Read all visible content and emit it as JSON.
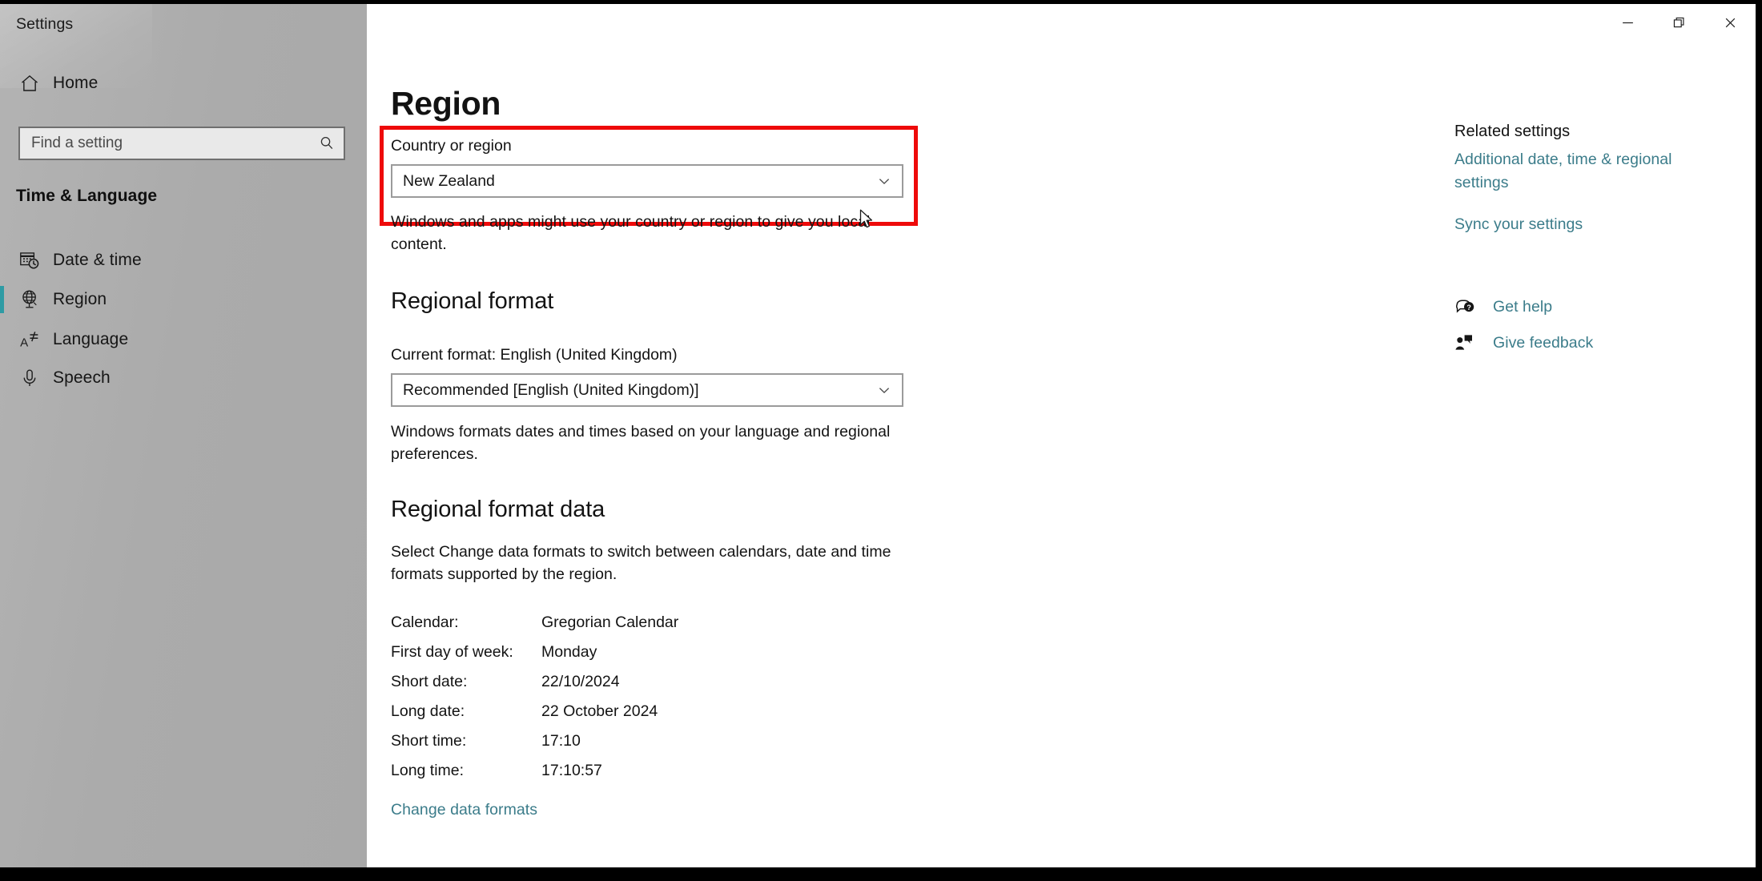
{
  "window": {
    "title": "Settings",
    "controls": [
      {
        "name": "minimize",
        "label": "Minimize"
      },
      {
        "name": "restore",
        "label": "Restore Down"
      },
      {
        "name": "close",
        "label": "Close"
      }
    ]
  },
  "sidebar": {
    "home": {
      "label": "Home",
      "icon": "home-icon"
    },
    "search": {
      "placeholder": "Find a setting",
      "value": "",
      "icon": "search-icon"
    },
    "group_header": "Time & Language",
    "items": [
      {
        "label": "Date & time",
        "icon": "calendar-clock-icon",
        "selected": false
      },
      {
        "label": "Region",
        "icon": "globe-icon",
        "selected": true
      },
      {
        "label": "Language",
        "icon": "language-icon",
        "selected": false
      },
      {
        "label": "Speech",
        "icon": "microphone-icon",
        "selected": false
      }
    ]
  },
  "main": {
    "page_title": "Region",
    "country_section": {
      "label": "Country or region",
      "selected_value": "New Zealand",
      "description": "Windows and apps might use your country or region to give you local content.",
      "highlighted": true
    },
    "regional_format_section": {
      "heading": "Regional format",
      "current_format_line": "Current format: English (United Kingdom)",
      "selected_value": "Recommended [English (United Kingdom)]",
      "description": "Windows formats dates and times based on your language and regional preferences."
    },
    "regional_format_data_section": {
      "heading": "Regional format data",
      "description": "Select Change data formats to switch between calendars, date and time formats supported by the region.",
      "rows": [
        {
          "key": "Calendar:",
          "value": "Gregorian Calendar"
        },
        {
          "key": "First day of week:",
          "value": "Monday"
        },
        {
          "key": "Short date:",
          "value": "22/10/2024"
        },
        {
          "key": "Long date:",
          "value": "22 October 2024"
        },
        {
          "key": "Short time:",
          "value": "17:10"
        },
        {
          "key": "Long time:",
          "value": "17:10:57"
        }
      ],
      "change_link": "Change data formats"
    }
  },
  "right_rail": {
    "related_title": "Related settings",
    "links": [
      {
        "label": "Additional date, time & regional settings"
      },
      {
        "label": "Sync your settings"
      }
    ],
    "actions": [
      {
        "label": "Get help",
        "icon": "help-bubble-icon"
      },
      {
        "label": "Give feedback",
        "icon": "feedback-person-icon"
      }
    ]
  },
  "colors": {
    "accent": "#2e9ba4",
    "link": "#3b7c8a",
    "highlight_box": "#ee0a0a",
    "sidebar_bg": "#ababab",
    "content_bg": "#ffffff"
  }
}
